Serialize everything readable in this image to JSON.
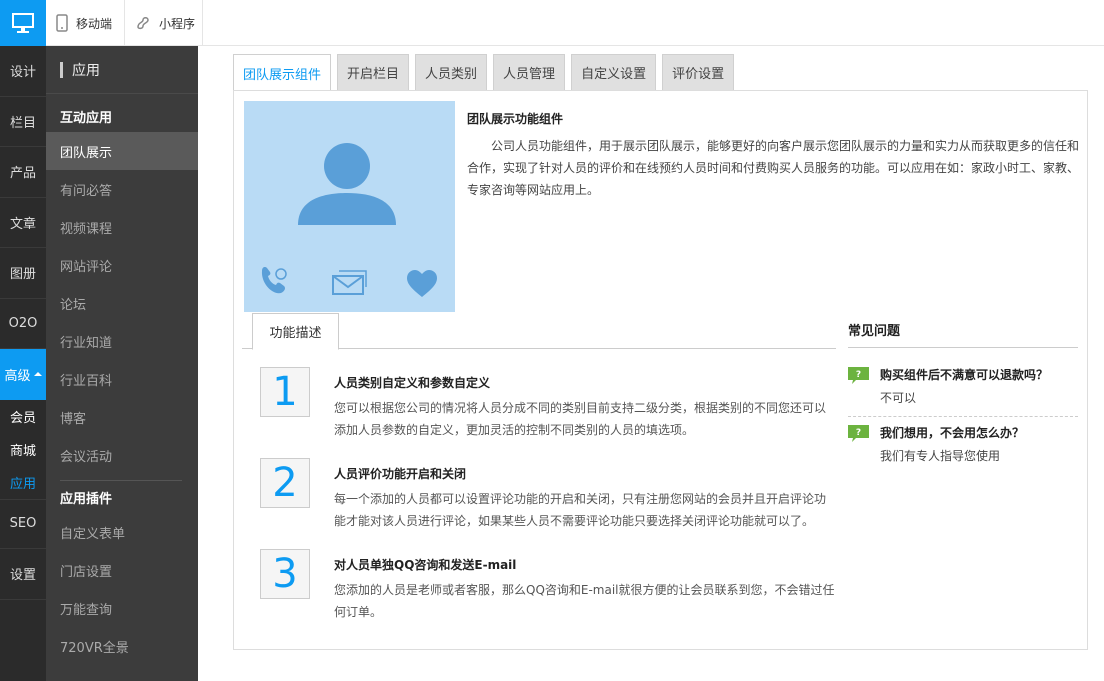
{
  "topbar": {
    "tabs": [
      {
        "label": "移动端",
        "icon": "phone-icon"
      },
      {
        "label": "小程序",
        "icon": "mini-program-icon"
      }
    ]
  },
  "nav1": {
    "items": [
      "设计",
      "栏目",
      "产品",
      "文章",
      "图册",
      "O2O"
    ],
    "group_label": "高级",
    "sub_items": [
      "会员",
      "商城",
      "应用"
    ],
    "items_after": [
      "SEO",
      "设置"
    ]
  },
  "nav2": {
    "header": "应用",
    "group1": "互动应用",
    "group1_items": [
      "团队展示",
      "有问必答",
      "视频课程",
      "网站评论",
      "论坛",
      "行业知道",
      "行业百科",
      "博客",
      "会议活动"
    ],
    "group2": "应用插件",
    "group2_items": [
      "自定义表单",
      "门店设置",
      "万能查询",
      "720VR全景"
    ]
  },
  "tabs": [
    "团队展示组件",
    "开启栏目",
    "人员类别",
    "人员管理",
    "自定义设置",
    "评价设置"
  ],
  "intro": {
    "title": "团队展示功能组件",
    "text": "公司人员功能组件，用于展示团队展示，能够更好的向客户展示您团队展示的力量和实力从而获取更多的信任和合作，实现了针对人员的评价和在线预约人员时间和付费购买人员服务的功能。可以应用在如：家政小时工、家教、专家咨询等网站应用上。"
  },
  "feature_tab": "功能描述",
  "features": [
    {
      "num": "1",
      "title": "人员类别自定义和参数自定义",
      "desc": "您可以根据您公司的情况将人员分成不同的类别目前支持二级分类，根据类别的不同您还可以添加人员参数的自定义，更加灵活的控制不同类别的人员的填选项。"
    },
    {
      "num": "2",
      "title": "人员评价功能开启和关闭",
      "desc": "每一个添加的人员都可以设置评论功能的开启和关闭，只有注册您网站的会员并且开启评论功能才能对该人员进行评论，如果某些人员不需要评论功能只要选择关闭评论功能就可以了。"
    },
    {
      "num": "3",
      "title": "对人员单独QQ咨询和发送E-mail",
      "desc": "您添加的人员是老师或者客服，那么QQ咨询和E-mail就很方便的让会员联系到您，不会错过任何订单。"
    }
  ],
  "faq": {
    "title": "常见问题",
    "items": [
      {
        "q": "购买组件后不满意可以退款吗？",
        "a": "不可以"
      },
      {
        "q": "我们想用，不会用怎么办？",
        "a": "我们有专人指导您使用"
      }
    ]
  },
  "colors": {
    "accent": "#0d9bf2",
    "sidebar": "#2b2b2b",
    "sidebar2": "#3c3c3c",
    "faq_icon": "#6cb33f"
  }
}
